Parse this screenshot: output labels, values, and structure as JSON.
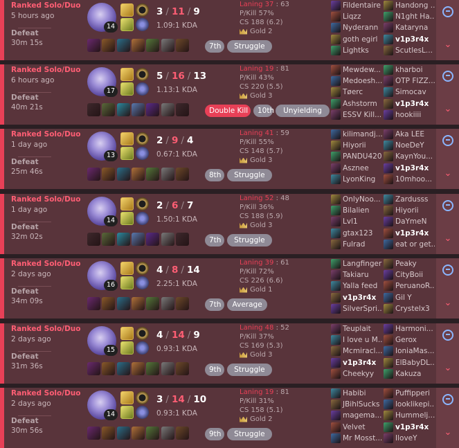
{
  "games": [
    {
      "queue": "Ranked Solo/Duo",
      "time": "5 hours ago",
      "result": "Defeat",
      "duration": "30m 15s",
      "level": "14",
      "k": "3",
      "d": "11",
      "a": "9",
      "kda": "1.09:1 KDA",
      "laning": "Laning 37",
      "laning_n": "63",
      "pkill": "P/Kill 57%",
      "cs": "CS 188 (6.2)",
      "tier": "Gold 2",
      "badges": [
        "7th",
        "Struggle"
      ],
      "team1": [
        "Fildentaire",
        "Liqzz",
        "Nyderann",
        "goth egirl",
        "Lightks"
      ],
      "team2": [
        "Handong ...",
        "N1ght Ha...",
        "Kataryna",
        "v1p3r4x",
        "ScutlesL..."
      ],
      "me_team": 2,
      "me_index": 3
    },
    {
      "queue": "Ranked Solo/Duo",
      "time": "6 hours ago",
      "result": "Defeat",
      "duration": "40m 21s",
      "level": "17",
      "k": "5",
      "d": "16",
      "a": "13",
      "kda": "1.13:1 KDA",
      "laning": "Laning 19",
      "laning_n": "81",
      "pkill": "P/Kill 43%",
      "cs": "CS 220 (5.5)",
      "tier": "Gold 3",
      "badges": [
        "Double Kill",
        "10th",
        "Unyielding"
      ],
      "team1": [
        "Mewdew...",
        "Medoesh...",
        "Tøerc",
        "Ashstorm",
        "ESSV Kill..."
      ],
      "team2": [
        "kharboi",
        "OTP FIZZ...",
        "Simocav",
        "v1p3r4x",
        "hookiiii"
      ],
      "me_team": 2,
      "me_index": 3
    },
    {
      "queue": "Ranked Solo/Duo",
      "time": "1 day ago",
      "result": "Defeat",
      "duration": "25m 46s",
      "level": "13",
      "k": "2",
      "d": "9",
      "a": "4",
      "kda": "0.67:1 KDA",
      "laning": "Laning 41",
      "laning_n": "59",
      "pkill": "P/Kill 55%",
      "cs": "CS 148 (5.7)",
      "tier": "Gold 3",
      "badges": [
        "8th",
        "Struggle"
      ],
      "team1": [
        "kilimandj...",
        "Hiyorii",
        "PANDU420",
        "Asznee",
        "LyonKing"
      ],
      "team2": [
        "Aka LEE",
        "NoeDeY",
        "KaynYou...",
        "v1p3r4x",
        "10mhoo..."
      ],
      "me_team": 2,
      "me_index": 3
    },
    {
      "queue": "Ranked Solo/Duo",
      "time": "1 day ago",
      "result": "Defeat",
      "duration": "32m 02s",
      "level": "14",
      "k": "2",
      "d": "6",
      "a": "7",
      "kda": "1.50:1 KDA",
      "laning": "Laning 52",
      "laning_n": "48",
      "pkill": "P/Kill 36%",
      "cs": "CS 188 (5.9)",
      "tier": "Gold 3",
      "badges": [
        "7th",
        "Struggle"
      ],
      "team1": [
        "OnlyNoo...",
        "Bilalien",
        "Lvl1",
        "gtax123",
        "Fulrad"
      ],
      "team2": [
        "Zardusss",
        "Hiyorii",
        "DaYmeN",
        "v1p3r4x",
        "eat or get..."
      ],
      "me_team": 2,
      "me_index": 3
    },
    {
      "queue": "Ranked Solo/Duo",
      "time": "2 days ago",
      "result": "Defeat",
      "duration": "34m 09s",
      "level": "16",
      "k": "4",
      "d": "8",
      "a": "14",
      "kda": "2.25:1 KDA",
      "laning": "Laning 39",
      "laning_n": "61",
      "pkill": "P/Kill 72%",
      "cs": "CS 226 (6.6)",
      "tier": "Gold 1",
      "badges": [
        "7th",
        "Average"
      ],
      "team1": [
        "Langfinger",
        "Takiaru",
        "Yalla feed",
        "v1p3r4x",
        "SilverSpri..."
      ],
      "team2": [
        "Peaky",
        "CityBoii",
        "PeruanoR...",
        "Gil Y",
        "Crystelx3"
      ],
      "me_team": 1,
      "me_index": 3
    },
    {
      "queue": "Ranked Solo/Duo",
      "time": "2 days ago",
      "result": "Defeat",
      "duration": "31m 36s",
      "level": "15",
      "k": "4",
      "d": "14",
      "a": "9",
      "kda": "0.93:1 KDA",
      "laning": "Laning 48",
      "laning_n": "52",
      "pkill": "P/Kill 37%",
      "cs": "CS 169 (5.3)",
      "tier": "Gold 3",
      "badges": [
        "9th",
        "Struggle"
      ],
      "team1": [
        "Teuplait",
        "I love u M...",
        "Mcmiracl...",
        "v1p3r4x",
        "Cheekyy"
      ],
      "team2": [
        "Harmoni...",
        "Gerox",
        "IoniaMas...",
        "ElBabyDL...",
        "Kakuza"
      ],
      "me_team": 1,
      "me_index": 3
    },
    {
      "queue": "Ranked Solo/Duo",
      "time": "2 days ago",
      "result": "Defeat",
      "duration": "30m 56s",
      "level": "14",
      "k": "3",
      "d": "14",
      "a": "10",
      "kda": "0.93:1 KDA",
      "laning": "Laning 19",
      "laning_n": "81",
      "pkill": "P/Kill 31%",
      "cs": "CS 158 (5.1)",
      "tier": "Gold 2",
      "badges": [
        "9th",
        "Struggle"
      ],
      "team1": [
        "Habibi",
        "JBihlSucks",
        "magema...",
        "Velvet",
        "Mr Mosst..."
      ],
      "team2": [
        "Puffipperi",
        "looklikepi...",
        "Hummelj...",
        "v1p3r4x",
        "IloveY"
      ],
      "me_team": 2,
      "me_index": 3
    }
  ],
  "colors": {
    "defeat_accent": "#e84057",
    "card_bg": "#59343b"
  }
}
